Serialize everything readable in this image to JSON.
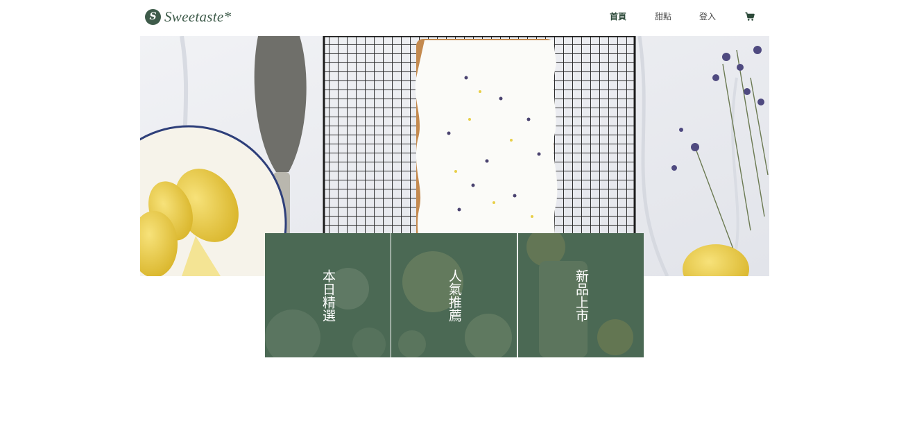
{
  "brand": {
    "logo_mark": "S",
    "name": "Sweetaste*"
  },
  "nav": {
    "items": [
      "首頁",
      "甜點",
      "登入"
    ],
    "active_index": 0,
    "cart_icon": "shopping-cart-icon"
  },
  "tiles": [
    {
      "label": "本日精選"
    },
    {
      "label": "人氣推薦"
    },
    {
      "label": "新品上市"
    }
  ],
  "colors": {
    "brand_green": "#3e5b4a",
    "tile_overlay": "#466450"
  }
}
